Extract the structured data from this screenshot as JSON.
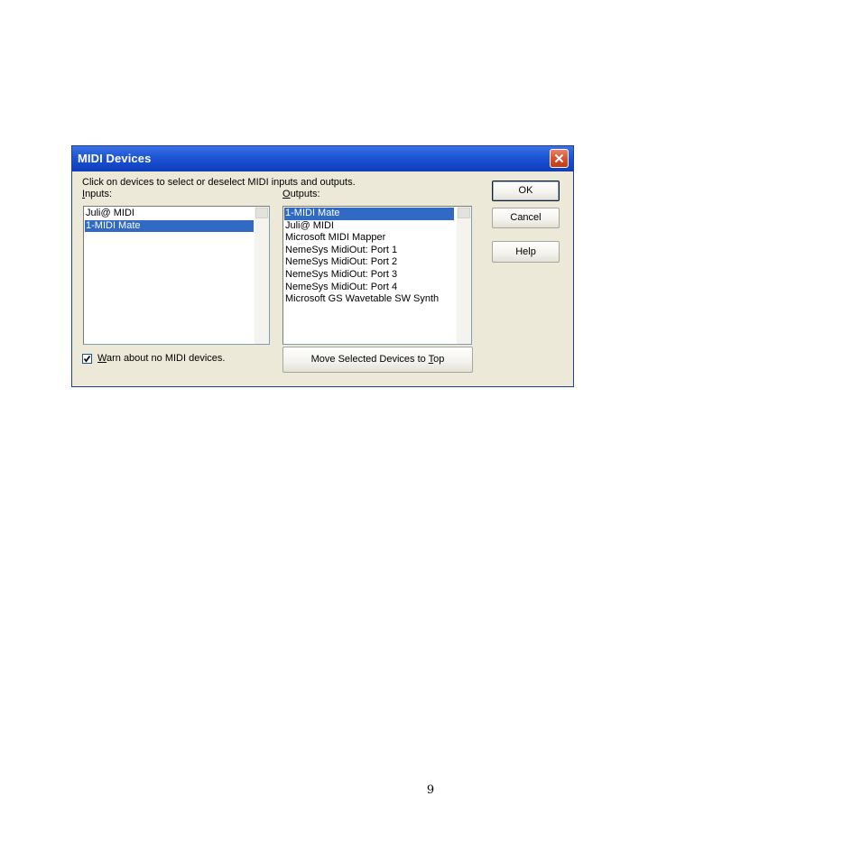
{
  "dialog": {
    "title": "MIDI Devices",
    "instruction": "Click on devices to select or deselect MIDI inputs and outputs.",
    "inputs": {
      "label": "Inputs:",
      "items": [
        {
          "label": "Juli@ MIDI",
          "selected": false
        },
        {
          "label": "1-MIDI Mate",
          "selected": true
        }
      ]
    },
    "outputs": {
      "label": "Outputs:",
      "items": [
        {
          "label": "1-MIDI Mate",
          "selected": true
        },
        {
          "label": "Juli@ MIDI",
          "selected": false
        },
        {
          "label": "Microsoft MIDI Mapper",
          "selected": false
        },
        {
          "label": "NemeSys MidiOut: Port 1",
          "selected": false
        },
        {
          "label": "NemeSys MidiOut: Port 2",
          "selected": false
        },
        {
          "label": "NemeSys MidiOut: Port 3",
          "selected": false
        },
        {
          "label": "NemeSys MidiOut: Port 4",
          "selected": false
        },
        {
          "label": "Microsoft GS Wavetable SW Synth",
          "selected": false
        }
      ]
    },
    "buttons": {
      "ok": "OK",
      "cancel": "Cancel",
      "help": "Help",
      "move_top": "Move Selected Devices to Top"
    },
    "warn_checkbox": {
      "label": "Warn about no MIDI devices.",
      "checked": true
    },
    "icons": {
      "close": "close-icon",
      "check": "checkmark-icon"
    },
    "colors": {
      "titlebar": "#1f57d6",
      "selection": "#316ac5",
      "close_button": "#d9532f",
      "background": "#ece9d8"
    }
  },
  "page_number": "9"
}
